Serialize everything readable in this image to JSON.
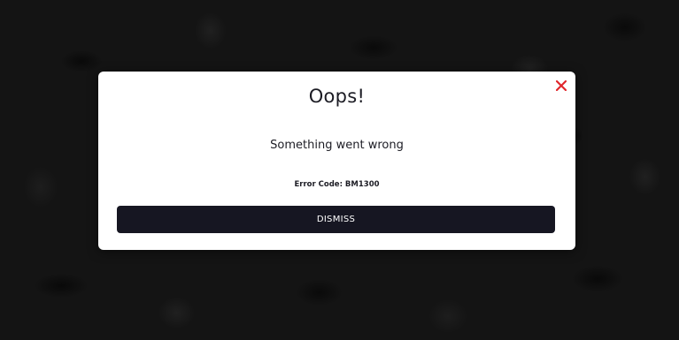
{
  "dialog": {
    "title": "Oops!",
    "message": "Something went wrong",
    "error_code": "Error Code: BM1300",
    "dismiss_label": "DISMISS",
    "close_icon": "close-icon"
  },
  "colors": {
    "close_icon": "#e0262b",
    "button_bg": "#161622",
    "text": "#1c1c24",
    "modal_bg": "#ffffff",
    "page_bg": "#141414"
  }
}
